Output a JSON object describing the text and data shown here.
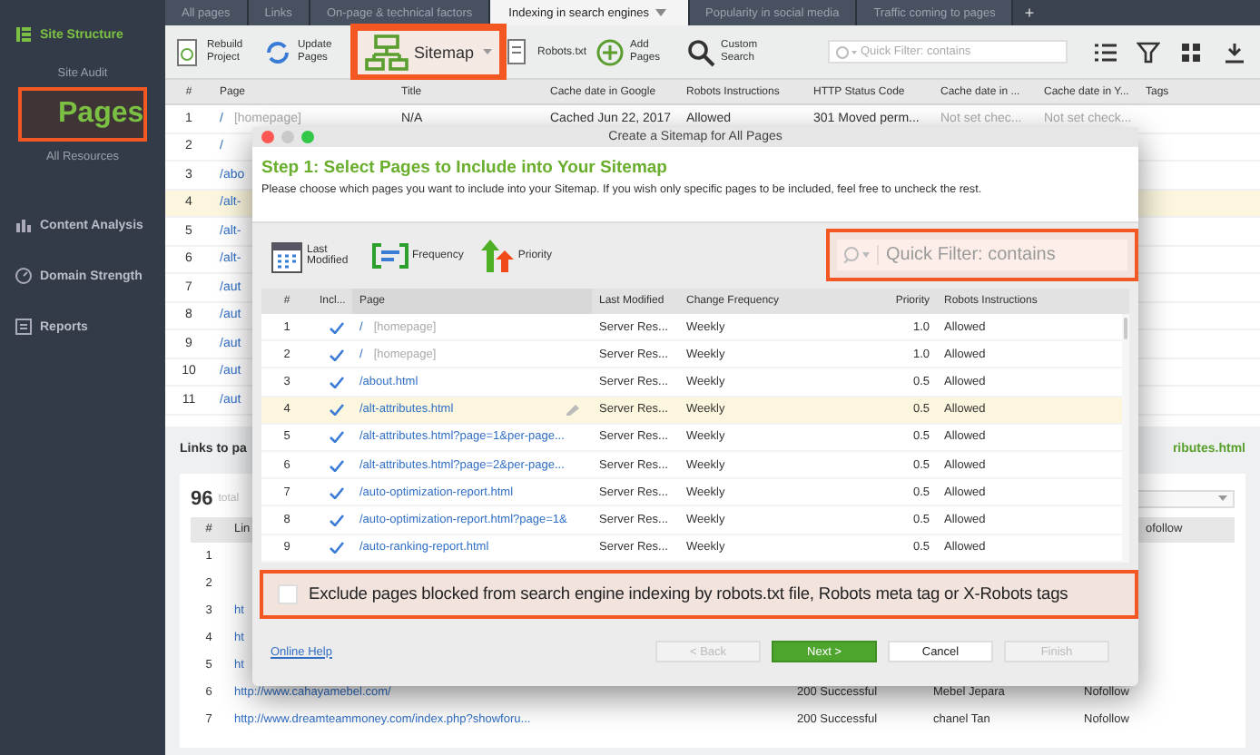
{
  "sidebar": {
    "items": [
      {
        "label": "Site Structure",
        "kind": "section",
        "selected": false,
        "highlighted": false
      },
      {
        "label": "Site Audit",
        "kind": "sub",
        "selected": false,
        "highlighted": false
      },
      {
        "label": "Pages",
        "kind": "sub",
        "selected": true,
        "highlighted": true
      },
      {
        "label": "All Resources",
        "kind": "sub",
        "selected": false,
        "highlighted": false
      },
      {
        "label": "Content Analysis",
        "kind": "section",
        "selected": false,
        "highlighted": false
      },
      {
        "label": "Domain Strength",
        "kind": "section",
        "selected": false,
        "highlighted": false
      },
      {
        "label": "Reports",
        "kind": "section",
        "selected": false,
        "highlighted": false
      }
    ]
  },
  "tabs": [
    {
      "label": "All pages",
      "selected": false
    },
    {
      "label": "Links",
      "selected": false
    },
    {
      "label": "On-page & technical factors",
      "selected": false
    },
    {
      "label": "Indexing in search engines",
      "selected": true
    },
    {
      "label": "Popularity in social media",
      "selected": false
    },
    {
      "label": "Traffic coming to pages",
      "selected": false
    }
  ],
  "add_tab": "+",
  "toolbar": {
    "buttons": [
      {
        "label": "Rebuild Project",
        "kind": "stacked",
        "highlighted": false
      },
      {
        "label": "Update Pages",
        "kind": "stacked",
        "highlighted": false
      },
      {
        "label": "Sitemap",
        "kind": "large",
        "highlighted": true
      },
      {
        "label": "Robots.txt",
        "kind": "inline",
        "highlighted": false
      },
      {
        "label": "Add Pages",
        "kind": "stacked",
        "highlighted": false
      },
      {
        "label": "Custom Search",
        "kind": "stacked",
        "highlighted": false
      }
    ],
    "filter": {
      "placeholder": "Quick Filter: contains"
    }
  },
  "table": {
    "columns": [
      "#",
      "Page",
      "Title",
      "Cache date in Google",
      "Robots Instructions",
      "HTTP Status Code",
      "Cache date in ...",
      "Cache date in Y...",
      "Tags"
    ],
    "rows": [
      {
        "number": "1",
        "page": "/",
        "hint": "[homepage]",
        "cells": [
          "N/A",
          "Cached Jun 22, 2017",
          "Allowed",
          "301 Moved perm...",
          "Not set chec...",
          "Not set check..."
        ],
        "selected": false
      },
      {
        "number": "2",
        "page": "/",
        "selected": false
      },
      {
        "number": "3",
        "page": "/abo",
        "selected": false
      },
      {
        "number": "4",
        "page": "/alt-",
        "selected": true
      },
      {
        "number": "5",
        "page": "/alt-",
        "selected": false
      },
      {
        "number": "6",
        "page": "/alt-",
        "selected": false
      },
      {
        "number": "7",
        "page": "/aut",
        "selected": false
      },
      {
        "number": "8",
        "page": "/aut",
        "selected": false
      },
      {
        "number": "9",
        "page": "/aut",
        "selected": false
      },
      {
        "number": "10",
        "page": "/aut",
        "selected": false
      },
      {
        "number": "11",
        "page": "/aut",
        "selected": false
      }
    ]
  },
  "links_panel": {
    "title": "Links to pa",
    "page_link": "ributes.html",
    "count": "96",
    "count_label": "total",
    "columns": [
      "#",
      "Lin",
      "ofollow"
    ],
    "rows": [
      {
        "number": "1"
      },
      {
        "number": "2"
      },
      {
        "number": "3",
        "link": "ht"
      },
      {
        "number": "4",
        "link": "ht"
      },
      {
        "number": "5",
        "link": "ht"
      },
      {
        "number": "6",
        "link": "http://www.cahayamebel.com/",
        "status": "200 Successful",
        "anchor": "Mebel Jepara",
        "follow": "Nofollow"
      },
      {
        "number": "7",
        "link": "http://www.dreamteammoney.com/index.php?showforu...",
        "status": "200 Successful",
        "anchor": "chanel Tan",
        "follow": "Nofollow"
      }
    ]
  },
  "dialog": {
    "title": "Create a Sitemap for All Pages",
    "step_title": "Step 1: Select Pages to Include into Your Sitemap",
    "description": "Please choose which pages you want to include into your Sitemap. If you wish only specific pages to be included, feel free to uncheck the rest.",
    "tools": [
      {
        "label": "Last Modified"
      },
      {
        "label": "Frequency"
      },
      {
        "label": "Priority"
      }
    ],
    "filter": {
      "placeholder": "Quick Filter: contains",
      "highlighted": true
    },
    "columns": [
      "#",
      "Incl...",
      "Page",
      "Last Modified",
      "Change Frequency",
      "Priority",
      "Robots Instructions"
    ],
    "rows": [
      {
        "number": "1",
        "included": true,
        "page": "/",
        "hint": "[homepage]",
        "last_modified": "Server Res...",
        "frequency": "Weekly",
        "priority": "1.0",
        "robots": "Allowed",
        "selected": false
      },
      {
        "number": "2",
        "included": true,
        "page": "/",
        "hint": "[homepage]",
        "last_modified": "Server Res...",
        "frequency": "Weekly",
        "priority": "1.0",
        "robots": "Allowed",
        "selected": false
      },
      {
        "number": "3",
        "included": true,
        "page": "/about.html",
        "last_modified": "Server Res...",
        "frequency": "Weekly",
        "priority": "0.5",
        "robots": "Allowed",
        "selected": false
      },
      {
        "number": "4",
        "included": true,
        "page": "/alt-attributes.html",
        "last_modified": "Server Res...",
        "frequency": "Weekly",
        "priority": "0.5",
        "robots": "Allowed",
        "selected": true
      },
      {
        "number": "5",
        "included": true,
        "page": "/alt-attributes.html?page=1&per-page...",
        "last_modified": "Server Res...",
        "frequency": "Weekly",
        "priority": "0.5",
        "robots": "Allowed",
        "selected": false
      },
      {
        "number": "6",
        "included": true,
        "page": "/alt-attributes.html?page=2&per-page...",
        "last_modified": "Server Res...",
        "frequency": "Weekly",
        "priority": "0.5",
        "robots": "Allowed",
        "selected": false
      },
      {
        "number": "7",
        "included": true,
        "page": "/auto-optimization-report.html",
        "last_modified": "Server Res...",
        "frequency": "Weekly",
        "priority": "0.5",
        "robots": "Allowed",
        "selected": false
      },
      {
        "number": "8",
        "included": true,
        "page": "/auto-optimization-report.html?page=1&",
        "last_modified": "Server Res...",
        "frequency": "Weekly",
        "priority": "0.5",
        "robots": "Allowed",
        "selected": false
      },
      {
        "number": "9",
        "included": true,
        "page": "/auto-ranking-report.html",
        "last_modified": "Server Res...",
        "frequency": "Weekly",
        "priority": "0.5",
        "robots": "Allowed",
        "selected": false
      }
    ],
    "exclude": {
      "label": "Exclude pages blocked from search engine indexing by robots.txt file, Robots meta tag or X-Robots tags",
      "checked": false,
      "highlighted": true
    },
    "help_link": "Online Help",
    "buttons": [
      {
        "label": "< Back",
        "kind": "disabled"
      },
      {
        "label": "Next >",
        "kind": "primary"
      },
      {
        "label": "Cancel",
        "kind": "normal"
      },
      {
        "label": "Finish",
        "kind": "disabled"
      }
    ]
  }
}
